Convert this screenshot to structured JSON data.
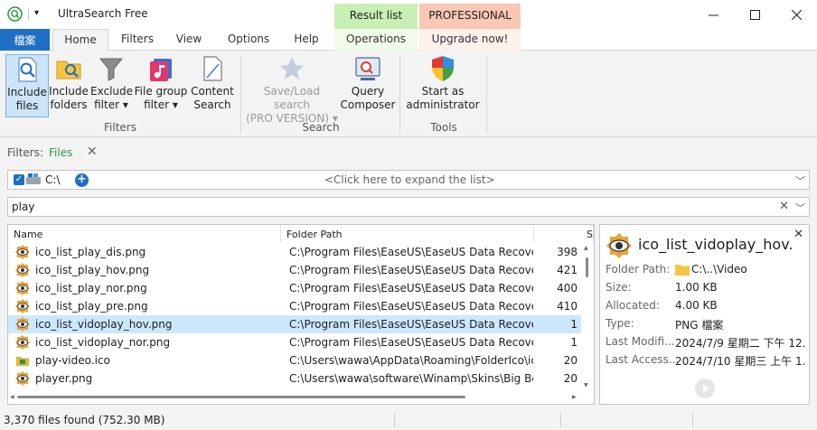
{
  "window": {
    "title": "UltraSearch Free"
  },
  "context_tabs": {
    "result_list": "Result list",
    "professional": "PROFESSIONAL"
  },
  "tabs": {
    "file": "檔案",
    "home": "Home",
    "filters": "Filters",
    "view": "View",
    "options": "Options",
    "help": "Help",
    "operations": "Operations",
    "upgrade": "Upgrade now!"
  },
  "ribbon": {
    "include_files": [
      "Include",
      "files"
    ],
    "include_folders": [
      "Include",
      "folders"
    ],
    "exclude_filter": [
      "Exclude",
      "filter ▾"
    ],
    "file_group_filter": [
      "File group",
      "filter ▾"
    ],
    "content_search": [
      "Content",
      "Search"
    ],
    "save_load_search": [
      "Save/Load search",
      "(PRO VERSION) ▾"
    ],
    "query_composer": [
      "Query",
      "Composer"
    ],
    "start_admin": [
      "Start as",
      "administrator"
    ],
    "groups": {
      "filters": "Filters",
      "search": "Search",
      "tools": "Tools"
    }
  },
  "filters_bar": {
    "label": "Filters:",
    "value": "Files"
  },
  "drive_bar": {
    "drive": "C:\\",
    "expand_hint": "<Click here to expand the list>"
  },
  "search": {
    "query": "play"
  },
  "table": {
    "columns": {
      "name": "Name",
      "path": "Folder Path",
      "size": "S"
    },
    "rows": [
      {
        "name": "ico_list_play_dis.png",
        "path": "C:\\Program Files\\EaseUS\\EaseUS Data Recovery ...",
        "size": "398"
      },
      {
        "name": "ico_list_play_hov.png",
        "path": "C:\\Program Files\\EaseUS\\EaseUS Data Recovery ...",
        "size": "421"
      },
      {
        "name": "ico_list_play_nor.png",
        "path": "C:\\Program Files\\EaseUS\\EaseUS Data Recovery ...",
        "size": "400"
      },
      {
        "name": "ico_list_play_pre.png",
        "path": "C:\\Program Files\\EaseUS\\EaseUS Data Recovery ...",
        "size": "410"
      },
      {
        "name": "ico_list_vidoplay_hov.png",
        "path": "C:\\Program Files\\EaseUS\\EaseUS Data Recovery ...",
        "size": "1"
      },
      {
        "name": "ico_list_vidoplay_nor.png",
        "path": "C:\\Program Files\\EaseUS\\EaseUS Data Recovery ...",
        "size": "1"
      },
      {
        "name": "play-video.ico",
        "path": "C:\\Users\\wawa\\AppData\\Roaming\\FolderIco\\icon...",
        "size": "20"
      },
      {
        "name": "player.png",
        "path": "C:\\Users\\wawa\\software\\Winamp\\Skins\\Big Bent...",
        "size": "20"
      }
    ],
    "selected_index": 4
  },
  "preview": {
    "title": "ico_list_vidoplay_hov...",
    "fields": [
      {
        "label": "Folder Path:",
        "value": "C:\\..\\Video"
      },
      {
        "label": "Size:",
        "value": "1.00 KB"
      },
      {
        "label": "Allocated:",
        "value": "4.00 KB"
      },
      {
        "label": "Type:",
        "value": "PNG 檔案"
      },
      {
        "label": "Last Modifi...",
        "value": "2024/7/9 星期二 下午 12..."
      },
      {
        "label": "Last Access...",
        "value": "2024/7/10 星期三 上午 1..."
      }
    ]
  },
  "status": {
    "text": "3,370 files found (752.30 MB)"
  },
  "colors": {
    "accent": "#1f6fc4",
    "selected_row": "#cce8ff",
    "filter_value": "#2a9a3a"
  }
}
